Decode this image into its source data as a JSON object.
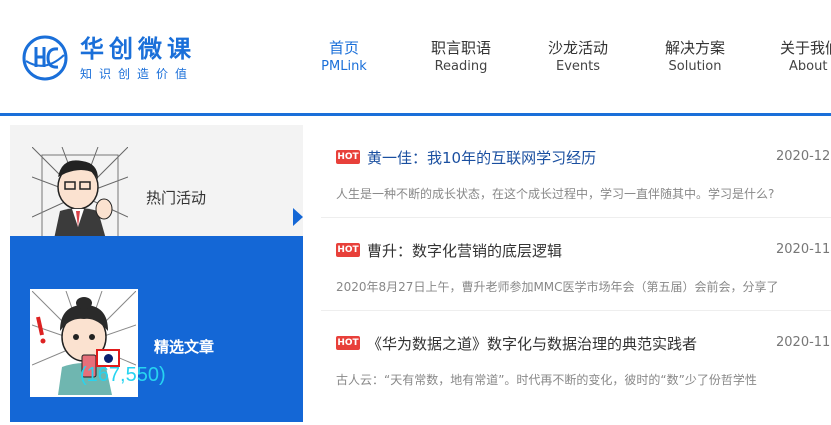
{
  "brand": {
    "title": "华创微课",
    "subtitle": "知识创造价值",
    "color": "#1a6fd9"
  },
  "nav": [
    {
      "cn": "首页",
      "en": "PMLink",
      "active": true
    },
    {
      "cn": "职言职语",
      "en": "Reading",
      "active": false
    },
    {
      "cn": "沙龙活动",
      "en": "Events",
      "active": false
    },
    {
      "cn": "解决方案",
      "en": "Solution",
      "active": false
    },
    {
      "cn": "关于我们",
      "en": "About",
      "active": false
    }
  ],
  "categories": [
    {
      "label": "热门活动",
      "icon": "comic-man-icon",
      "selected": false
    },
    {
      "label": "精选文章",
      "icon": "comic-woman-icon",
      "selected": true
    }
  ],
  "articles": [
    {
      "badge": "HOT",
      "title": "黄一佳：我10年的互联网学习经历",
      "date": "2020-12",
      "summary": "人生是一种不断的成长状态，在这个成长过程中，学习一直伴随其中。学习是什么?"
    },
    {
      "badge": "HOT",
      "title": "曹升：数字化营销的底层逻辑",
      "date": "2020-11",
      "summary": "2020年8月27日上午，曹升老师参加MMC医学市场年会（第五届）会前会，分享了"
    },
    {
      "badge": "HOT",
      "title": "《华为数据之道》数字化与数据治理的典范实践者",
      "date": "2020-11",
      "summary": "古人云：“天有常数，地有常道”。时代再不断的变化，彼时的“数”少了份哲学性"
    }
  ],
  "overlay": {
    "coordinate": "(167,550)"
  },
  "colors": {
    "accent": "#1467d6",
    "hot_badge": "#e8403a",
    "panel_bg": "#f3f3f3"
  }
}
